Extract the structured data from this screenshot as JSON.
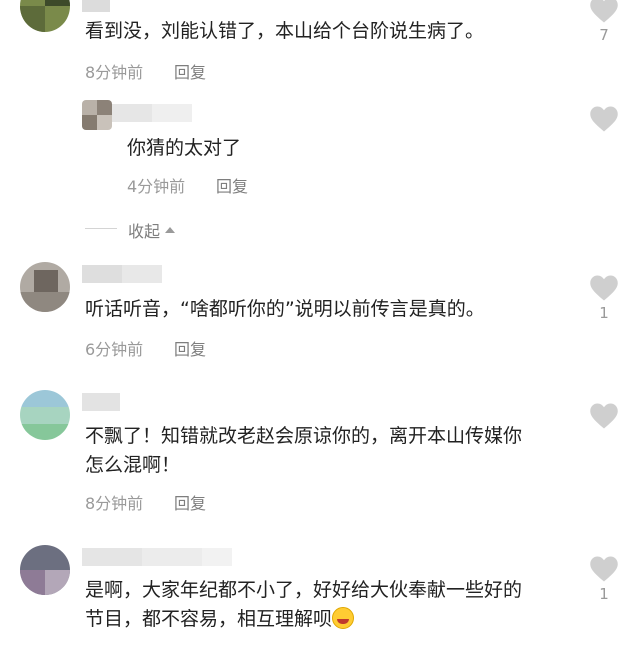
{
  "comments": [
    {
      "text": "看到没，刘能认错了，本山给个台阶说生病了。",
      "time": "8分钟前",
      "reply_label": "回复",
      "likes": "7"
    },
    {
      "text": "你猜的太对了",
      "time": "4分钟前",
      "reply_label": "回复",
      "likes": ""
    },
    {
      "text": "听话听音，“啥都听你的”说明以前传言是真的。",
      "time": "6分钟前",
      "reply_label": "回复",
      "likes": "1"
    },
    {
      "text_line1": "不飘了！知错就改老赵会原谅你的，离开本山传媒你",
      "text_line2": "怎么混啊！",
      "time": "8分钟前",
      "reply_label": "回复",
      "likes": ""
    },
    {
      "text_line1": "是啊，大家年纪都不小了，好好给大伙奉献一些好的",
      "text_line2": "节目，都不容易，相互理解呗",
      "likes": "1"
    }
  ],
  "collapse_label": "收起",
  "icons": {
    "like": "heart-icon",
    "collapse": "caret-up-icon",
    "emoji": "rofl-emoji-icon"
  },
  "colors": {
    "meta": "#9a9a9a",
    "heart": "#cfcfcf",
    "text": "#222222"
  }
}
